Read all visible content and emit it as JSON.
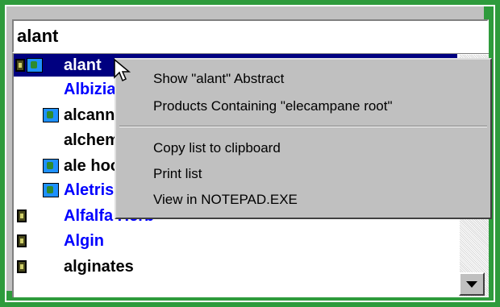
{
  "search": {
    "value": "alant"
  },
  "list": {
    "items": [
      {
        "label": "alant",
        "color": "white",
        "icons": [
          "doc-icon",
          "globe-icon"
        ],
        "selected": true
      },
      {
        "label": "Albizia",
        "color": "blue",
        "icons": []
      },
      {
        "label": "alcanna",
        "color": "black",
        "icons": [
          "globe-icon"
        ]
      },
      {
        "label": "alchemilla",
        "color": "black",
        "icons": []
      },
      {
        "label": "ale hoof",
        "color": "black",
        "icons": [
          "globe-icon"
        ]
      },
      {
        "label": "Aletris",
        "color": "blue",
        "icons": [
          "globe-icon"
        ]
      },
      {
        "label": "Alfalfa Herb",
        "color": "blue",
        "icons": [
          "doc-icon"
        ]
      },
      {
        "label": "Algin",
        "color": "blue",
        "icons": [
          "doc-icon"
        ]
      },
      {
        "label": "alginates",
        "color": "black",
        "icons": [
          "doc-icon"
        ]
      }
    ]
  },
  "context_menu": {
    "items": [
      "Show \"alant\" Abstract",
      "Products Containing \"elecampane root\"",
      "Copy list to clipboard",
      "Print list",
      "View in NOTEPAD.EXE"
    ]
  },
  "colors": {
    "frame": "#2e9b3c",
    "selection": "#000080",
    "link": "#0000ff"
  }
}
